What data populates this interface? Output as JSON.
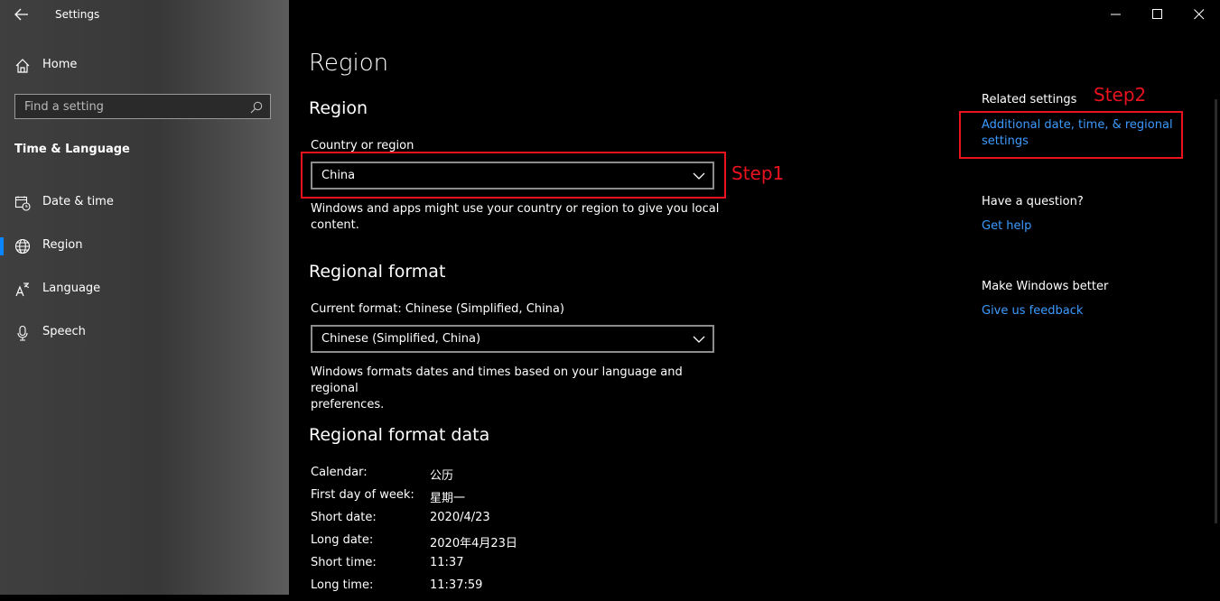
{
  "window": {
    "title": "Settings",
    "controls": {
      "minimize": "minimize-icon",
      "maximize": "maximize-icon",
      "close": "close-icon"
    }
  },
  "sidebar": {
    "home": {
      "label": "Home",
      "icon": "home-icon"
    },
    "search": {
      "placeholder": "Find a setting",
      "icon": "search-icon"
    },
    "section_title": "Time & Language",
    "items": [
      {
        "label": "Date & time",
        "icon": "calendar-clock-icon",
        "active": false
      },
      {
        "label": "Region",
        "icon": "globe-icon",
        "active": true
      },
      {
        "label": "Language",
        "icon": "language-icon",
        "active": false
      },
      {
        "label": "Speech",
        "icon": "microphone-icon",
        "active": false
      }
    ],
    "accent": "#0a84ff"
  },
  "main": {
    "title": "Region",
    "region_section": {
      "heading": "Region",
      "country_label": "Country or region",
      "country_value": "China",
      "description_line1": "Windows and apps might use your country or region to give you local",
      "description_line2": "content."
    },
    "format_section": {
      "heading": "Regional format",
      "current_label": "Current format: Chinese (Simplified, China)",
      "format_value": "Chinese (Simplified, China)",
      "description_line1": "Windows formats dates and times based on your language and regional",
      "description_line2": "preferences."
    },
    "data_section": {
      "heading": "Regional format data",
      "rows": [
        {
          "key": "Calendar:",
          "value": "公历"
        },
        {
          "key": "First day of week:",
          "value": "星期一"
        },
        {
          "key": "Short date:",
          "value": "2020/4/23"
        },
        {
          "key": "Long date:",
          "value": "2020年4月23日"
        },
        {
          "key": "Short time:",
          "value": "11:37"
        },
        {
          "key": "Long time:",
          "value": "11:37:59"
        }
      ]
    }
  },
  "rail": {
    "related_heading": "Related settings",
    "related_link_line1": "Additional date, time, & regional",
    "related_link_line2": "settings",
    "question_heading": "Have a question?",
    "help_link": "Get help",
    "better_heading": "Make Windows better",
    "feedback_link": "Give us feedback",
    "link_color": "#3d9bff"
  },
  "annotations": {
    "step1": "Step1",
    "step2": "Step2",
    "color": "#e8131f"
  }
}
